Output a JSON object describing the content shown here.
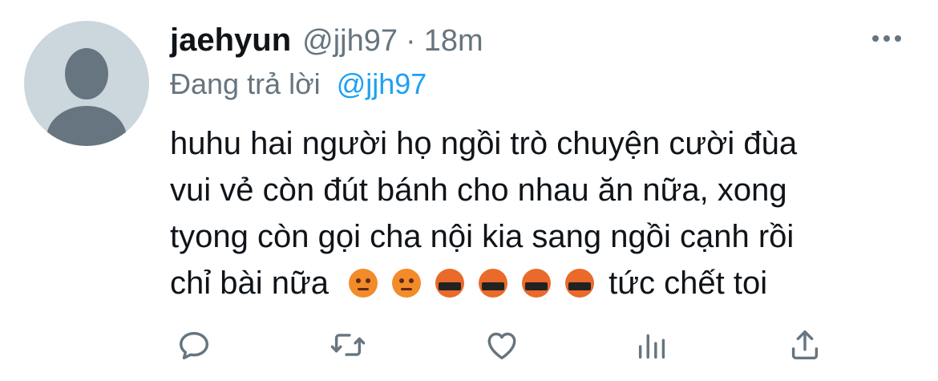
{
  "tweet": {
    "author": {
      "name": "jaehyun",
      "handle": "@jjh97",
      "separator": "·",
      "time": "18m"
    },
    "replying": {
      "prefix": "Đang trả lời",
      "mention": "@jjh97"
    },
    "text_lines": [
      "huhu hai người họ ngồi trò chuyện cười đùa",
      "vui vẻ còn đút bánh cho nhau ăn nữa, xong",
      "tyong còn gọi cha nội kia sang ngồi cạnh rồi"
    ],
    "last_line_start": "chỉ bài nữa",
    "emojis": [
      "pouting-face",
      "pouting-face",
      "face-with-symbols-on-mouth",
      "face-with-symbols-on-mouth",
      "face-with-symbols-on-mouth",
      "face-with-symbols-on-mouth"
    ],
    "last_line_end": "tức chết toi",
    "actions": [
      "reply-icon",
      "retweet-icon",
      "like-icon",
      "analytics-icon",
      "share-icon"
    ],
    "colors": {
      "text": "#0f1419",
      "muted": "#66757f",
      "link": "#1da1f2",
      "avatar_bg": "#ccd6dd"
    }
  }
}
